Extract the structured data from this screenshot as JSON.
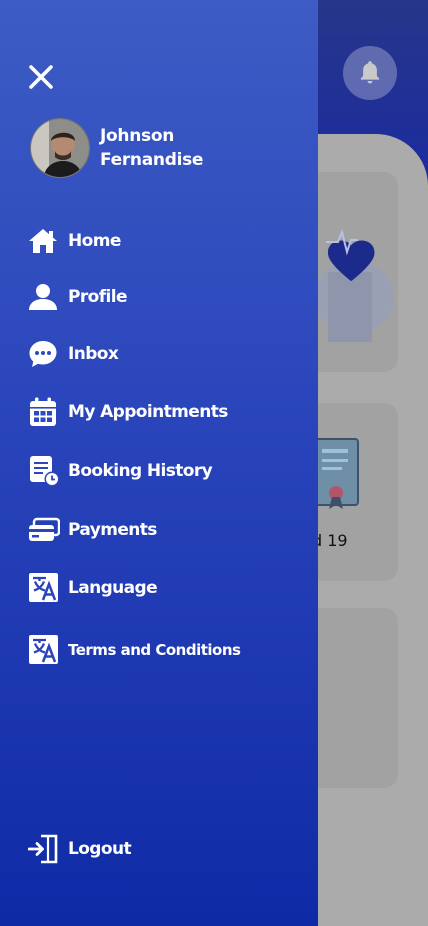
{
  "user": {
    "name": "Johnson Fernandise"
  },
  "menu": {
    "items": [
      {
        "label": "Home",
        "icon": "home-icon"
      },
      {
        "label": "Profile",
        "icon": "person-icon"
      },
      {
        "label": "Inbox",
        "icon": "chat-icon"
      },
      {
        "label": "My Appointments",
        "icon": "calendar-icon"
      },
      {
        "label": "Booking History",
        "icon": "history-icon"
      },
      {
        "label": "Payments",
        "icon": "payment-cards-icon"
      },
      {
        "label": "Language",
        "icon": "translate-icon"
      },
      {
        "label": "Terms and Conditions",
        "icon": "translate-icon"
      }
    ],
    "logout": {
      "label": "Logout",
      "icon": "logout-icon"
    }
  },
  "background": {
    "card2_label": "d 19"
  },
  "colors": {
    "drawer_top": "#3d5cc4",
    "drawer_bottom": "#0f2aa6",
    "overlay": "#ababab"
  }
}
